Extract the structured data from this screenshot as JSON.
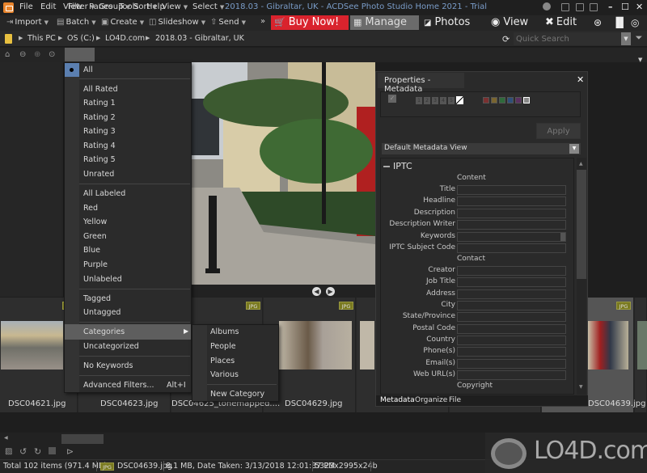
{
  "app": {
    "title": "2018.03 - Gibraltar, UK - ACDSee Photo Studio Home 2021 - Trial",
    "menu": [
      "File",
      "Edit",
      "View",
      "Panes",
      "Tools",
      "Help"
    ],
    "window_controls": {
      "minimize": "–",
      "maximize": "☐",
      "close": "✕"
    }
  },
  "toolbar": {
    "items": [
      {
        "label": "Import",
        "icon": "import-icon"
      },
      {
        "label": "Batch",
        "icon": "batch-icon"
      },
      {
        "label": "Create",
        "icon": "create-icon"
      },
      {
        "label": "Slideshow",
        "icon": "slideshow-icon"
      },
      {
        "label": "Send",
        "icon": "send-icon"
      }
    ],
    "more": "»",
    "buy_now": "Buy Now!",
    "modes": {
      "manage": "Manage",
      "photos": "Photos",
      "view": "View",
      "edit": "Edit"
    },
    "accent_colors": {
      "buy_now": "#d9232d",
      "manage_active": "#6b6b6b"
    }
  },
  "address": {
    "crumbs": [
      "This PC",
      "OS (C:)",
      "LO4D.com",
      "2018.03 - Gibraltar, UK"
    ],
    "quick_search_placeholder": "Quick Search"
  },
  "navbar": {
    "buttons": [
      "Filter",
      "Group",
      "Sort",
      "View",
      "Select"
    ]
  },
  "filter_menu": {
    "items": [
      {
        "label": "All",
        "checked": true
      },
      {
        "label": "All Rated"
      },
      {
        "label": "Rating 1"
      },
      {
        "label": "Rating 2"
      },
      {
        "label": "Rating 3"
      },
      {
        "label": "Rating 4"
      },
      {
        "label": "Rating 5"
      },
      {
        "label": "Unrated"
      },
      {
        "label": "All Labeled"
      },
      {
        "label": "Red"
      },
      {
        "label": "Yellow"
      },
      {
        "label": "Green"
      },
      {
        "label": "Blue"
      },
      {
        "label": "Purple"
      },
      {
        "label": "Unlabeled"
      },
      {
        "label": "Tagged"
      },
      {
        "label": "Untagged"
      },
      {
        "label": "Categories",
        "highlighted": true
      },
      {
        "label": "Uncategorized"
      },
      {
        "label": "No Keywords"
      },
      {
        "label": "Advanced Filters...",
        "shortcut": "Alt+I"
      }
    ],
    "submenu": [
      "Albums",
      "People",
      "Places",
      "Various",
      "New Category"
    ]
  },
  "properties": {
    "title": "Properties - Metadata",
    "rating_numbers": [
      "1",
      "2",
      "3",
      "4",
      "5"
    ],
    "color_labels": [
      "#7a3030",
      "#7a6530",
      "#2f6a3c",
      "#2f4f7a",
      "#5a3060",
      "#888888"
    ],
    "apply": "Apply",
    "metadata_view": "Default Metadata View",
    "section": "IPTC",
    "groups": [
      {
        "heading": "Content",
        "fields": [
          "Title",
          "Headline",
          "Description",
          "Description Writer",
          "Keywords",
          "IPTC Subject Code"
        ]
      },
      {
        "heading": "Contact",
        "fields": [
          "Creator",
          "Job Title",
          "Address",
          "City",
          "State/Province",
          "Postal Code",
          "Country",
          "Phone(s)",
          "Email(s)",
          "Web URL(s)"
        ]
      },
      {
        "heading": "Copyright",
        "fields": []
      }
    ],
    "tabs": [
      "Metadata",
      "Organize",
      "File"
    ]
  },
  "filmstrip": {
    "badge": "JPG",
    "files": [
      "DSC04621.jpg",
      "DSC04623.jpg",
      "DSC04625_tonemapped....",
      "DSC04629.jpg",
      "DSC04639.jpg"
    ]
  },
  "status": {
    "total": "Total 102 items  (971.4 MB)",
    "badge": "JPG",
    "file": "DSC04639.jpg",
    "info": "8.1 MB, Date Taken: 3/13/2018 12:01:37 PM",
    "dims": "5323x2995x24b"
  },
  "watermark": "LO4D.com"
}
